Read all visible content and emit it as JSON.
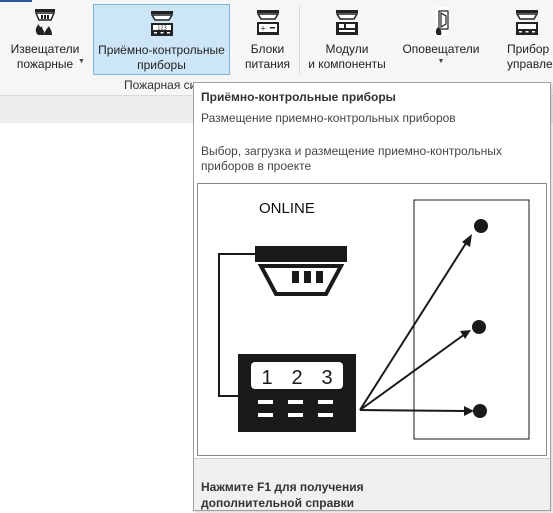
{
  "ribbon": {
    "buttons": [
      {
        "label_1": "Извещатели",
        "label_2": "пожарные",
        "icon": "fire-detector-icon",
        "dropdown": true
      },
      {
        "label_1": "Приёмно-контрольные",
        "label_2": "приборы",
        "icon": "control-panel-icon",
        "active": true
      },
      {
        "label_1": "Блоки",
        "label_2": "питания",
        "icon": "power-supply-icon"
      },
      {
        "label_1": "Модули",
        "label_2": "и компоненты",
        "icon": "modules-icon"
      },
      {
        "label_1": "Оповещатели",
        "label_2": "",
        "icon": "speaker-icon",
        "dropdown": true
      },
      {
        "label_1": "Прибор",
        "label_2": "управлен",
        "icon": "control-device-icon"
      }
    ],
    "group_label": "Пожарная си",
    "dropdown_arrow": "▼"
  },
  "tooltip": {
    "title": "Приёмно-контрольные приборы",
    "subtitle": "Размещение приемно-контрольных приборов",
    "description": "Выбор, загрузка и размещение приемно-контрольных приборов в проекте",
    "image": {
      "label": "ONLINE",
      "digits": [
        "1",
        "2",
        "3"
      ]
    },
    "help": "Нажмите F1 для получения дополнительной справки"
  },
  "colors": {
    "accent": "#2b5797",
    "active_bg": "#cde6f7",
    "active_border": "#7fb5df",
    "tooltip_footer": "#f0f0f0"
  }
}
